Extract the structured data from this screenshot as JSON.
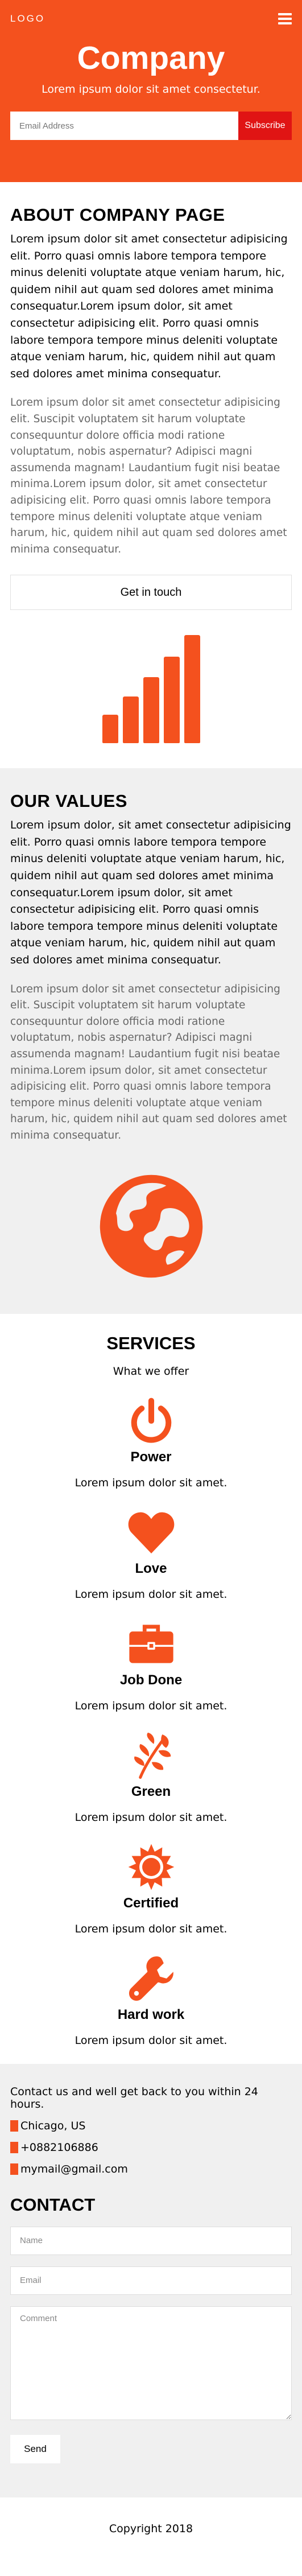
{
  "header": {
    "logo": "LOGO",
    "title": "Company",
    "tagline": "Lorem ipsum dolor sit amet consectetur.",
    "email_placeholder": "Email Address",
    "subscribe_label": "Subscribe"
  },
  "about": {
    "heading": "ABOUT COMPANY PAGE",
    "para1": "Lorem ipsum dolor sit amet consectetur adipisicing elit. Porro quasi omnis labore tempora tempore minus deleniti voluptate atque veniam harum, hic, quidem nihil aut quam sed dolores amet minima consequatur.Lorem ipsum dolor, sit amet consectetur adipisicing elit. Porro quasi omnis labore tempora tempore minus deleniti voluptate atque veniam harum, hic, quidem nihil aut quam sed dolores amet minima consequatur.",
    "para2": "Lorem ipsum dolor sit amet consectetur adipisicing elit. Suscipit voluptatem sit harum voluptate consequuntur dolore officia modi ratione voluptatum, nobis aspernatur? Adipisci magni assumenda magnam! Laudantium fugit nisi beatae minima.Lorem ipsum dolor, sit amet consectetur adipisicing elit. Porro quasi omnis labore tempora tempore minus deleniti voluptate atque veniam harum, hic, quidem nihil aut quam sed dolores amet minima consequatur.",
    "button_label": "Get in touch",
    "chart_icon": "signal-bars-icon"
  },
  "values": {
    "heading": "OUR VALUES",
    "para1": "Lorem ipsum dolor, sit amet consectetur adipisicing elit. Porro quasi omnis labore tempora tempore minus deleniti voluptate atque veniam harum, hic, quidem nihil aut quam sed dolores amet minima consequatur.Lorem ipsum dolor, sit amet consectetur adipisicing elit. Porro quasi omnis labore tempora tempore minus deleniti voluptate atque veniam harum, hic, quidem nihil aut quam sed dolores amet minima consequatur.",
    "para2": "Lorem ipsum dolor sit amet consectetur adipisicing elit. Suscipit voluptatem sit harum voluptate consequuntur dolore officia modi ratione voluptatum, nobis aspernatur? Adipisci magni assumenda magnam! Laudantium fugit nisi beatae minima.Lorem ipsum dolor, sit amet consectetur adipisicing elit. Porro quasi omnis labore tempora tempore minus deleniti voluptate atque veniam harum, hic, quidem nihil aut quam sed dolores amet minima consequatur.",
    "icon": "globe-icon"
  },
  "services": {
    "heading": "SERVICES",
    "subheading": "What we offer",
    "items": [
      {
        "icon": "power-icon",
        "name": "Power",
        "desc": "Lorem ipsum dolor sit amet."
      },
      {
        "icon": "heart-icon",
        "name": "Love",
        "desc": "Lorem ipsum dolor sit amet."
      },
      {
        "icon": "briefcase-icon",
        "name": "Job Done",
        "desc": "Lorem ipsum dolor sit amet."
      },
      {
        "icon": "leaf-icon",
        "name": "Green",
        "desc": "Lorem ipsum dolor sit amet."
      },
      {
        "icon": "certificate-icon",
        "name": "Certified",
        "desc": "Lorem ipsum dolor sit amet."
      },
      {
        "icon": "wrench-icon",
        "name": "Hard work",
        "desc": "Lorem ipsum dolor sit amet."
      }
    ]
  },
  "contact": {
    "intro": "Contact us and well get back to you within 24 hours.",
    "location": "Chicago, US",
    "phone": "+0882106886",
    "email": "mymail@gmail.com",
    "heading": "CONTACT",
    "name_placeholder": "Name",
    "email_placeholder": "Email",
    "comment_placeholder": "Comment",
    "send_label": "Send"
  },
  "footer": {
    "copyright": "Copyright 2018"
  },
  "colors": {
    "accent": "#f4511e",
    "subscribe": "#e01414",
    "section_grey": "#f0f0f0"
  }
}
